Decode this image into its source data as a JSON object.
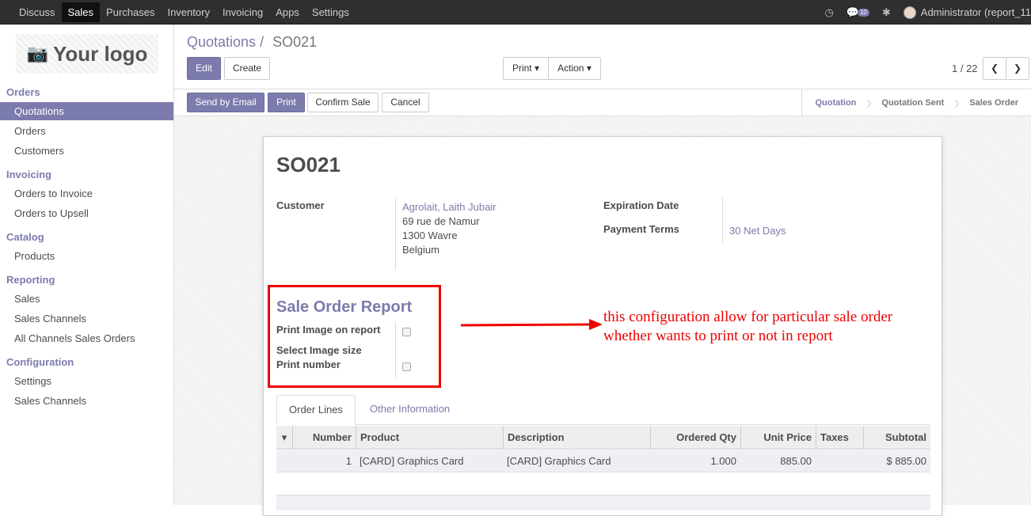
{
  "topbar": {
    "menu": [
      "Discuss",
      "Sales",
      "Purchases",
      "Inventory",
      "Invoicing",
      "Apps",
      "Settings"
    ],
    "active": "Sales",
    "messages_count": "10",
    "user": "Administrator (report_11"
  },
  "sidebar": {
    "logo_text": "Your logo",
    "sections": [
      {
        "title": "Orders",
        "items": [
          "Quotations",
          "Orders",
          "Customers"
        ]
      },
      {
        "title": "Invoicing",
        "items": [
          "Orders to Invoice",
          "Orders to Upsell"
        ]
      },
      {
        "title": "Catalog",
        "items": [
          "Products"
        ]
      },
      {
        "title": "Reporting",
        "items": [
          "Sales",
          "Sales Channels",
          "All Channels Sales Orders"
        ]
      },
      {
        "title": "Configuration",
        "items": [
          "Settings",
          "Sales Channels"
        ]
      }
    ],
    "active_item": "Quotations"
  },
  "control_panel": {
    "breadcrumb_parent": "Quotations",
    "breadcrumb_sep": "/",
    "breadcrumb_current": "SO021",
    "edit_label": "Edit",
    "create_label": "Create",
    "print_label": "Print",
    "action_label": "Action",
    "pager": "1 / 22"
  },
  "statusbar": {
    "send_email_label": "Send by Email",
    "print_label": "Print",
    "confirm_label": "Confirm Sale",
    "cancel_label": "Cancel",
    "stages": [
      "Quotation",
      "Quotation Sent",
      "Sales Order"
    ],
    "active_stage": "Quotation"
  },
  "form": {
    "name": "SO021",
    "customer_label": "Customer",
    "customer_name": "Agrolait, Laith Jubair",
    "address_line1": "69 rue de Namur",
    "address_line2": "1300 Wavre",
    "address_line3": "Belgium",
    "expiration_label": "Expiration Date",
    "payment_terms_label": "Payment Terms",
    "payment_terms_value": "30 Net Days",
    "report_section_title": "Sale Order Report",
    "print_image_label": "Print Image on report",
    "image_size_label": "Select Image size",
    "print_number_label": "Print number",
    "tabs": [
      "Order Lines",
      "Other Information"
    ],
    "columns": [
      "Number",
      "Product",
      "Description",
      "Ordered Qty",
      "Unit Price",
      "Taxes",
      "Subtotal"
    ],
    "lines": [
      {
        "number": "1",
        "product": "[CARD] Graphics Card",
        "description": "[CARD] Graphics Card",
        "qty": "1.000",
        "price": "885.00",
        "taxes": "",
        "subtotal": "$ 885.00"
      }
    ]
  },
  "annotation": {
    "line1": "this configuration allow for particular sale order",
    "line2": "whether wants to print or not in report",
    "color": "#e00000"
  },
  "colors": {
    "accent": "#7c7bad",
    "topbar": "#2f2f2f"
  }
}
